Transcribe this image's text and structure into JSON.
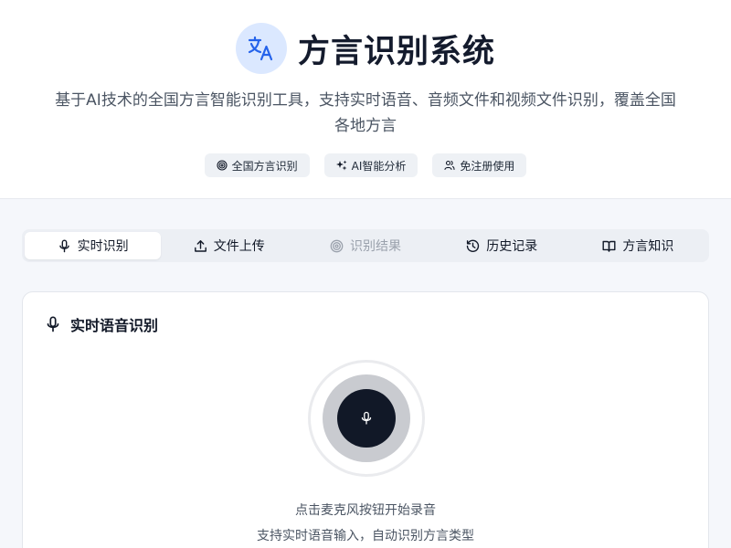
{
  "app": {
    "title": "方言识别系统",
    "subtitle": "基于AI技术的全国方言智能识别工具，支持实时语音、音频文件和视频文件识别，覆盖全国各地方言",
    "logo_icon": "translate-icon"
  },
  "badges": [
    {
      "label": "全国方言识别",
      "icon": "target-icon"
    },
    {
      "label": "AI智能分析",
      "icon": "sparkles-icon"
    },
    {
      "label": "免注册使用",
      "icon": "users-icon"
    }
  ],
  "tabs": [
    {
      "label": "实时识别",
      "icon": "mic-icon",
      "state": "active"
    },
    {
      "label": "文件上传",
      "icon": "upload-icon",
      "state": "normal"
    },
    {
      "label": "识别结果",
      "icon": "target-icon",
      "state": "disabled"
    },
    {
      "label": "历史记录",
      "icon": "history-icon",
      "state": "normal"
    },
    {
      "label": "方言知识",
      "icon": "book-icon",
      "state": "normal"
    }
  ],
  "card": {
    "title": "实时语音识别",
    "title_icon": "mic-icon",
    "hint_primary": "点击麦克风按钮开始录音",
    "hint_secondary": "支持实时语音输入，自动识别方言类型"
  },
  "colors": {
    "accent": "#2563eb",
    "logo_bg": "#dbe8ff",
    "mic_button": "#111827",
    "mic_ring": "#c9cbd0"
  }
}
